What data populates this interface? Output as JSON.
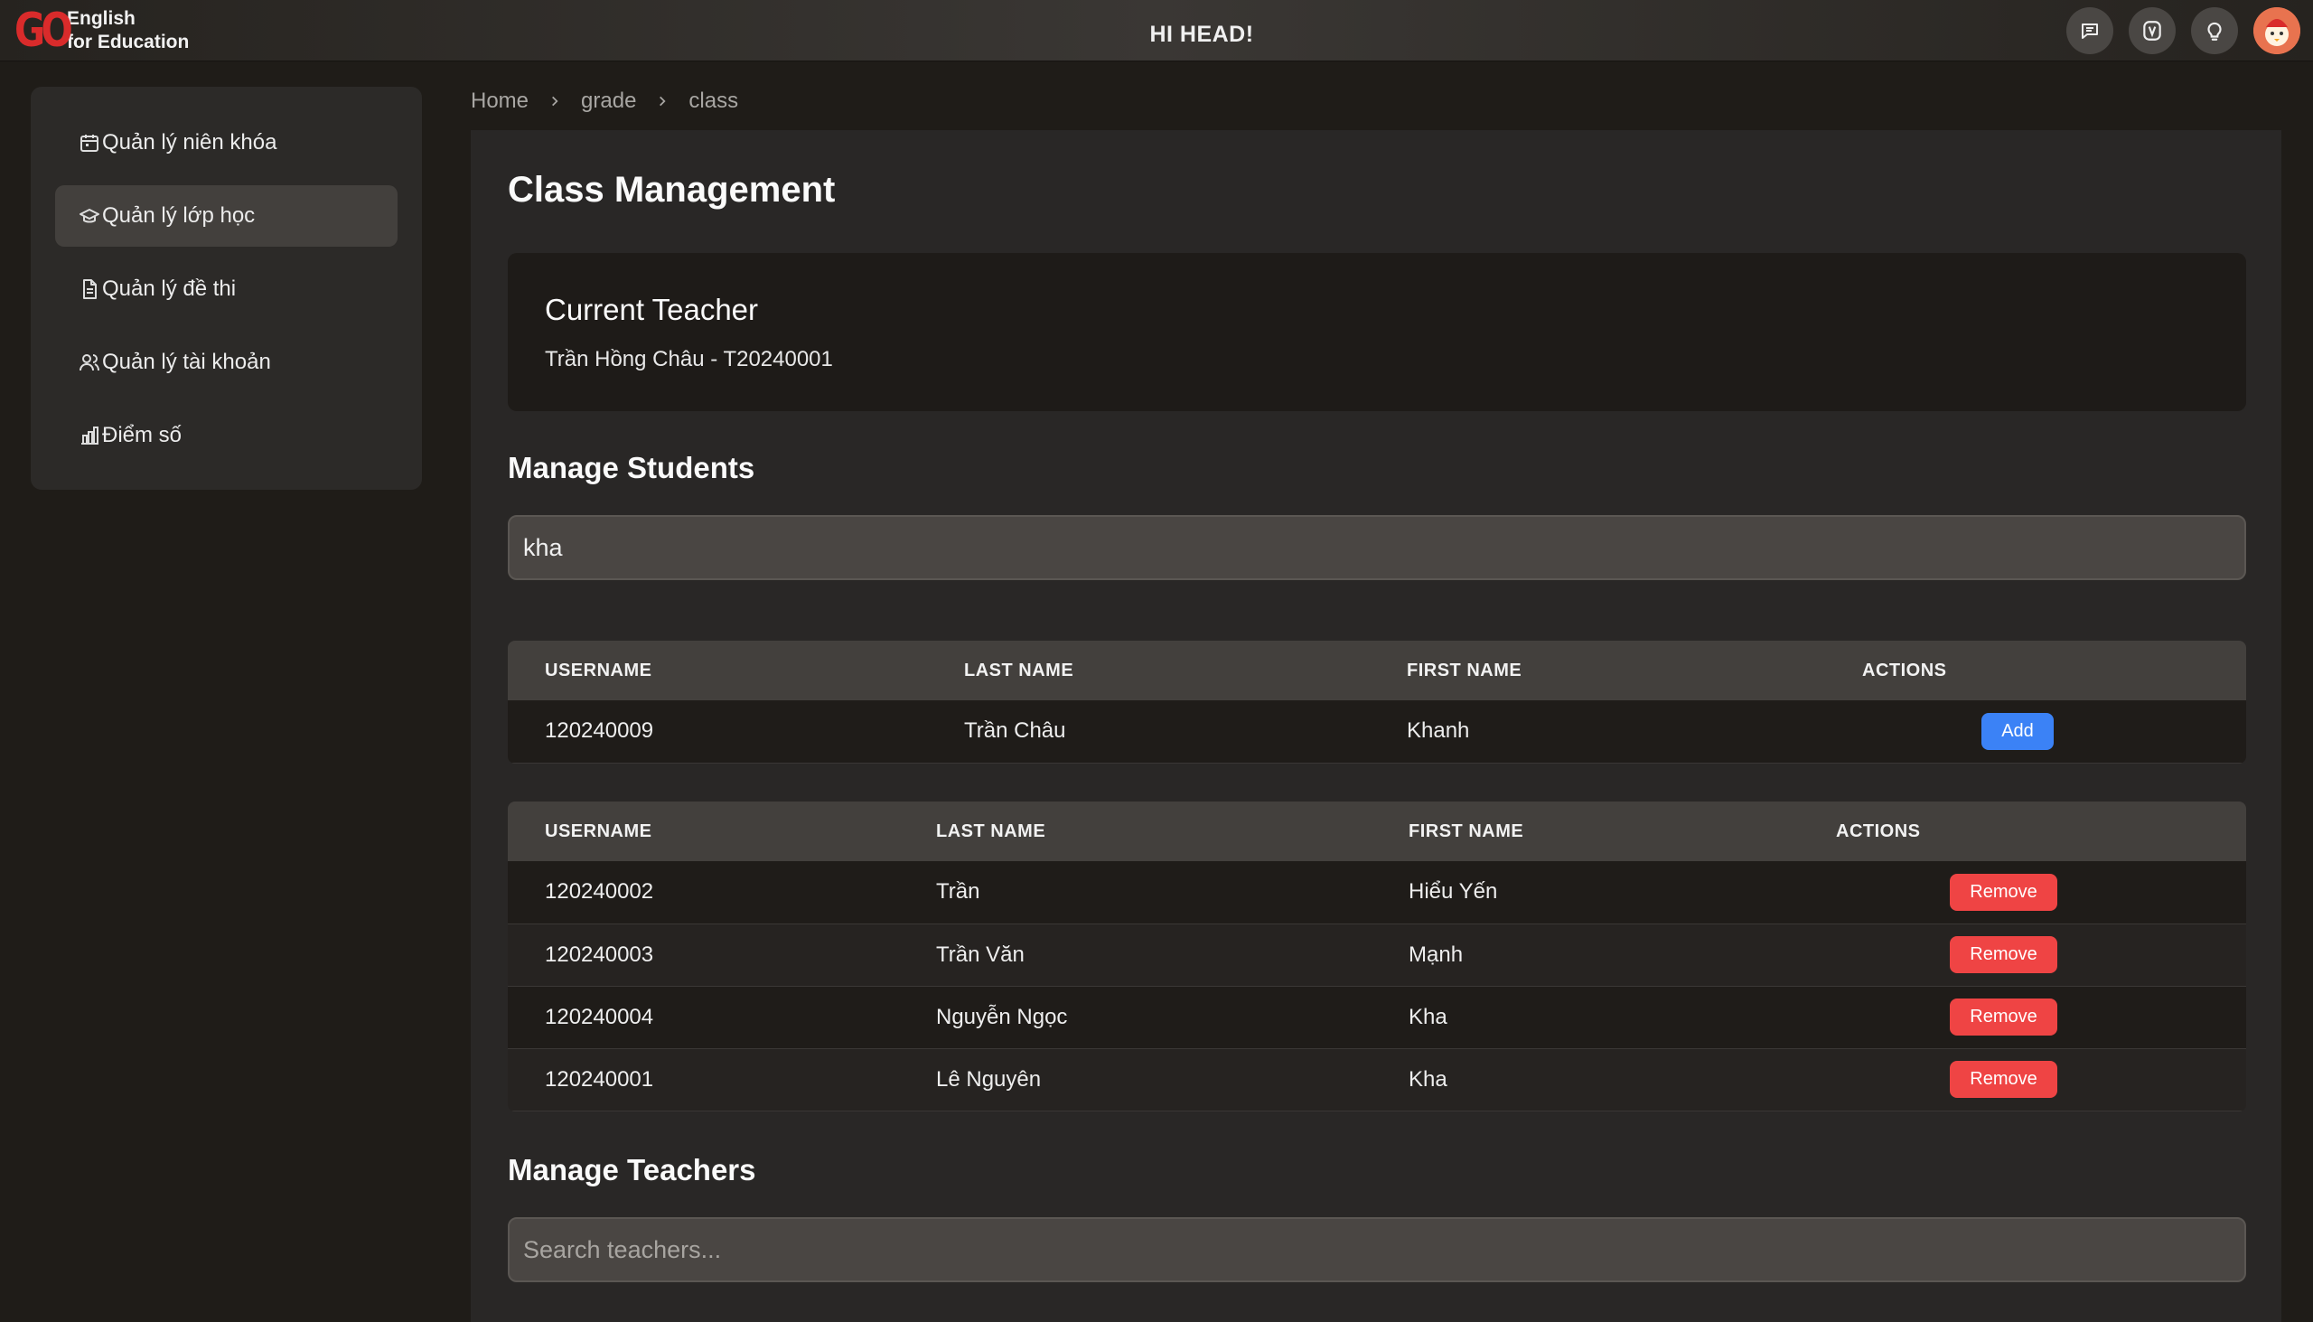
{
  "header": {
    "logo_mark": "GO",
    "logo_line1": "English",
    "logo_line2": "for Education",
    "greeting": "HI HEAD!",
    "icons": [
      "chat-icon",
      "v-badge-icon",
      "lightbulb-icon",
      "avatar"
    ]
  },
  "sidebar": {
    "items": [
      {
        "label": "Quản lý niên khóa",
        "icon": "calendar-icon",
        "active": false
      },
      {
        "label": "Quản lý lớp học",
        "icon": "graduation-cap-icon",
        "active": true
      },
      {
        "label": "Quản lý đề thi",
        "icon": "document-icon",
        "active": false
      },
      {
        "label": "Quản lý tài khoản",
        "icon": "users-icon",
        "active": false
      },
      {
        "label": "Điểm số",
        "icon": "bar-chart-icon",
        "active": false
      }
    ]
  },
  "breadcrumb": [
    "Home",
    "grade",
    "class"
  ],
  "main": {
    "title": "Class Management",
    "current_teacher": {
      "heading": "Current Teacher",
      "value": "Trần Hồng Châu - T20240001"
    },
    "students": {
      "heading": "Manage Students",
      "search_value": "kha",
      "columns": [
        "USERNAME",
        "LAST NAME",
        "FIRST NAME",
        "ACTIONS"
      ],
      "search_results": [
        {
          "username": "120240009",
          "last_name": "Trần Châu",
          "first_name": "Khanh",
          "action": "Add"
        }
      ],
      "enrolled": [
        {
          "username": "120240002",
          "last_name": "Trần",
          "first_name": "Hiểu Yến",
          "action": "Remove"
        },
        {
          "username": "120240003",
          "last_name": "Trần Văn",
          "first_name": "Mạnh",
          "action": "Remove"
        },
        {
          "username": "120240004",
          "last_name": "Nguyễn Ngọc",
          "first_name": "Kha",
          "action": "Remove"
        },
        {
          "username": "120240001",
          "last_name": "Lê Nguyên",
          "first_name": "Kha",
          "action": "Remove"
        }
      ]
    },
    "teachers": {
      "heading": "Manage Teachers",
      "search_placeholder": "Search teachers..."
    }
  },
  "colors": {
    "accent_add": "#3b82f6",
    "accent_remove": "#ef4444",
    "logo_red": "#d92b2b"
  }
}
